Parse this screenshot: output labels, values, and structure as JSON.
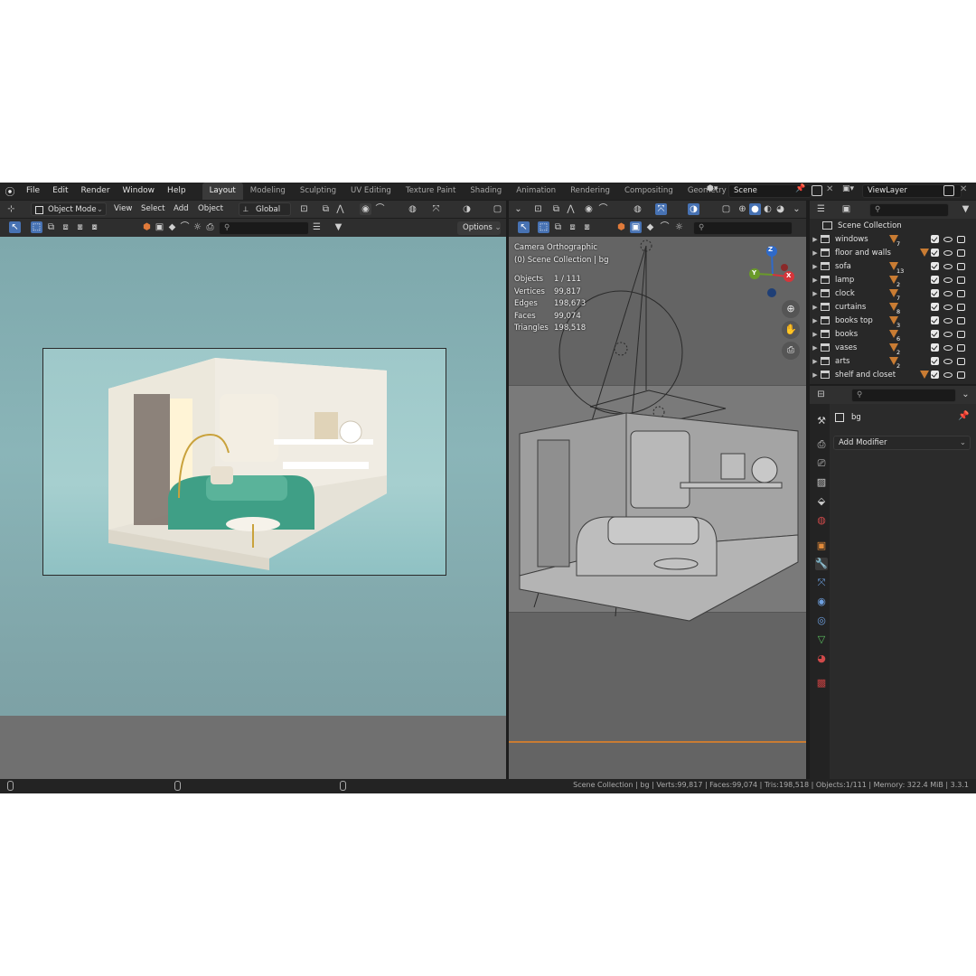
{
  "menu": [
    "File",
    "Edit",
    "Render",
    "Window",
    "Help"
  ],
  "workspaces": [
    {
      "label": "Layout",
      "active": true
    },
    {
      "label": "Modeling",
      "active": false
    },
    {
      "label": "Sculpting",
      "active": false
    },
    {
      "label": "UV Editing",
      "active": false
    },
    {
      "label": "Texture Paint",
      "active": false
    },
    {
      "label": "Shading",
      "active": false
    },
    {
      "label": "Animation",
      "active": false
    },
    {
      "label": "Rendering",
      "active": false
    },
    {
      "label": "Compositing",
      "active": false
    },
    {
      "label": "Geometry Nodes",
      "active": false
    }
  ],
  "scene": {
    "name": "Scene"
  },
  "view_layer": {
    "name": "ViewLayer"
  },
  "toolbar": {
    "mode": "Object Mode",
    "view": "View",
    "select": "Select",
    "add": "Add",
    "object": "Object",
    "transform_orientation": "Global",
    "options": "Options"
  },
  "viewport_right": {
    "camera_label": "Camera Orthographic",
    "collection_label": "(0) Scene Collection | bg",
    "stats": [
      {
        "label": "Objects",
        "value": "1 / 111"
      },
      {
        "label": "Vertices",
        "value": "99,817"
      },
      {
        "label": "Edges",
        "value": "198,673"
      },
      {
        "label": "Faces",
        "value": "99,074"
      },
      {
        "label": "Triangles",
        "value": "198,518"
      }
    ],
    "gizmo": {
      "z": "Z",
      "y": "Y",
      "x": "X"
    }
  },
  "outliner": {
    "root": "Scene Collection",
    "items": [
      {
        "name": "windows",
        "count": "7"
      },
      {
        "name": "floor and walls",
        "count": ""
      },
      {
        "name": "sofa",
        "count": "13"
      },
      {
        "name": "lamp",
        "count": "2"
      },
      {
        "name": "clock",
        "count": "7"
      },
      {
        "name": "curtains",
        "count": "8"
      },
      {
        "name": "books top",
        "count": "3"
      },
      {
        "name": "books",
        "count": "6"
      },
      {
        "name": "vases",
        "count": "2"
      },
      {
        "name": "arts",
        "count": "2"
      },
      {
        "name": "shelf and closet",
        "count": ""
      }
    ]
  },
  "properties": {
    "object": "bg",
    "add_modifier": "Add Modifier"
  },
  "statusbar": {
    "text": "Scene Collection | bg | Verts:99,817 | Faces:99,074 | Tris:198,518 | Objects:1/111 | Memory: 322.4 MiB | 3.3.1"
  },
  "colors": {
    "accent": "#4772b3",
    "orange": "#c97c33",
    "bg_teal": "#8fbcbf"
  }
}
